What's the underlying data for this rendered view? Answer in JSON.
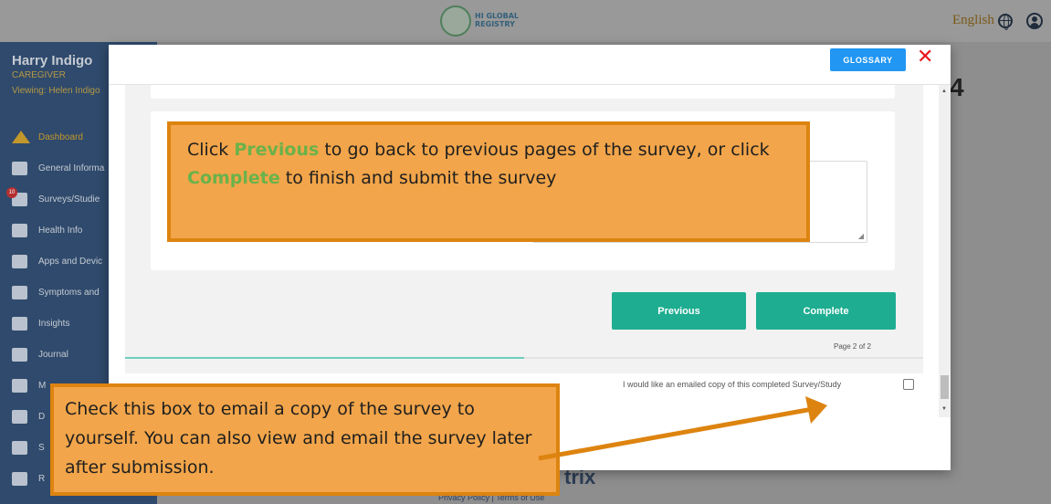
{
  "header": {
    "logo_line1": "HI GLOBAL",
    "logo_line2": "REGISTRY",
    "language": "English",
    "globe_icon": "globe-icon",
    "account_icon": "user-icon"
  },
  "sidebar": {
    "user_name": "Harry Indigo",
    "role": "CAREGIVER",
    "viewing": "Viewing: Helen Indigo",
    "items": [
      {
        "label": "Dashboard",
        "icon": "home-icon",
        "active": true
      },
      {
        "label": "General Informa",
        "icon": "id-card-icon"
      },
      {
        "label": "Surveys/Studie",
        "icon": "survey-icon",
        "badge": "10"
      },
      {
        "label": "Health Info",
        "icon": "plus-icon"
      },
      {
        "label": "Apps and Devic",
        "icon": "laptop-icon"
      },
      {
        "label": "Symptoms and",
        "icon": "heart-icon"
      },
      {
        "label": "Insights",
        "icon": "chart-icon"
      },
      {
        "label": "Journal",
        "icon": "journal-icon"
      },
      {
        "label": "M",
        "icon": "mail-icon"
      },
      {
        "label": "D",
        "icon": "folder-icon"
      },
      {
        "label": "S",
        "icon": "share-icon"
      },
      {
        "label": "R",
        "icon": "people-icon"
      }
    ]
  },
  "background": {
    "page_char": "4",
    "footer_brand": "trix",
    "footer_links": "Privacy Policy | Terms of Use"
  },
  "modal": {
    "glossary_label": "GLOSSARY",
    "close_label": "✕",
    "previous_label": "Previous",
    "complete_label": "Complete",
    "page_indicator": "Page 2 of 2",
    "progress_percent": 50,
    "email_copy_label": "I would like an emailed copy of this completed Survey/Study",
    "email_copy_checked": false
  },
  "callouts": {
    "one": {
      "t1": "Click ",
      "h1": "Previous",
      "t2": " to go back to previous pages of the survey, or click ",
      "h2": "Complete",
      "t3": " to finish and submit the survey"
    },
    "two": {
      "text": "Check this box to email a copy of the survey to yourself. You can also view and email the survey later after submission."
    }
  },
  "colors": {
    "sidebar_bg": "#2f4a6c",
    "accent_teal": "#1ead91",
    "glossary_blue": "#2196f3",
    "close_red": "#e8151b",
    "callout_fill": "#f2a54a",
    "callout_border": "#dd8410",
    "callout_highlight": "#6ab24a"
  }
}
